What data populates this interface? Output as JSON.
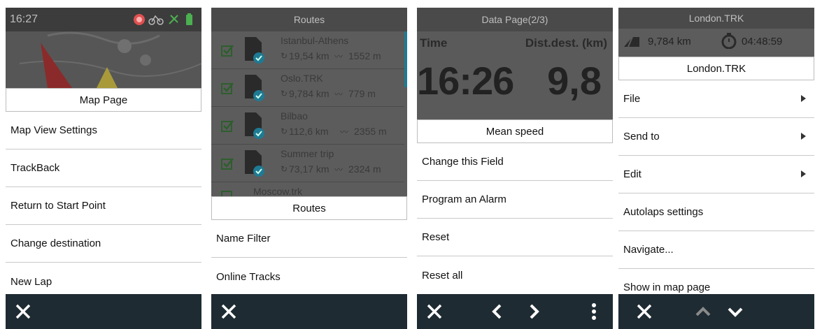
{
  "screen1": {
    "time": "16:27",
    "header": "Map Page",
    "items": [
      "Map View Settings",
      "TrackBack",
      "Return to Start Point",
      "Change destination",
      "New Lap"
    ]
  },
  "screen2": {
    "title": "Routes",
    "routes": [
      {
        "name": "Istanbul-Athens",
        "distance": "19,54 km",
        "elevation": "1552 m"
      },
      {
        "name": "Oslo.TRK",
        "distance": "9,784 km",
        "elevation": "779 m"
      },
      {
        "name": "Bilbao",
        "distance": "112,6 km",
        "elevation": "2355 m"
      },
      {
        "name": "Summer trip",
        "distance": "73,17 km",
        "elevation": "2324 m"
      },
      {
        "name": "Moscow.trk"
      }
    ],
    "header": "Routes",
    "items": [
      "Name Filter",
      "Online Tracks"
    ]
  },
  "screen3": {
    "title": "Data Page(2/3)",
    "field1": {
      "label": "Time",
      "value": "16:26"
    },
    "field2": {
      "label": "Dist.dest. (km)",
      "value": "9,8"
    },
    "header": "Mean speed",
    "items": [
      "Change this Field",
      "Program an Alarm",
      "Reset",
      "Reset all"
    ]
  },
  "screen4": {
    "title": "London.TRK",
    "distance": "9,784 km",
    "duration": "04:48:59",
    "header": "London.TRK",
    "items": [
      "File",
      "Send to",
      "Edit",
      "Autolaps settings",
      "Navigate...",
      "Show in map page"
    ]
  },
  "colors": {
    "bar": "#1e2b33",
    "accent_green": "#4caf50",
    "cyan": "#29b6d8",
    "red": "#e53935"
  }
}
